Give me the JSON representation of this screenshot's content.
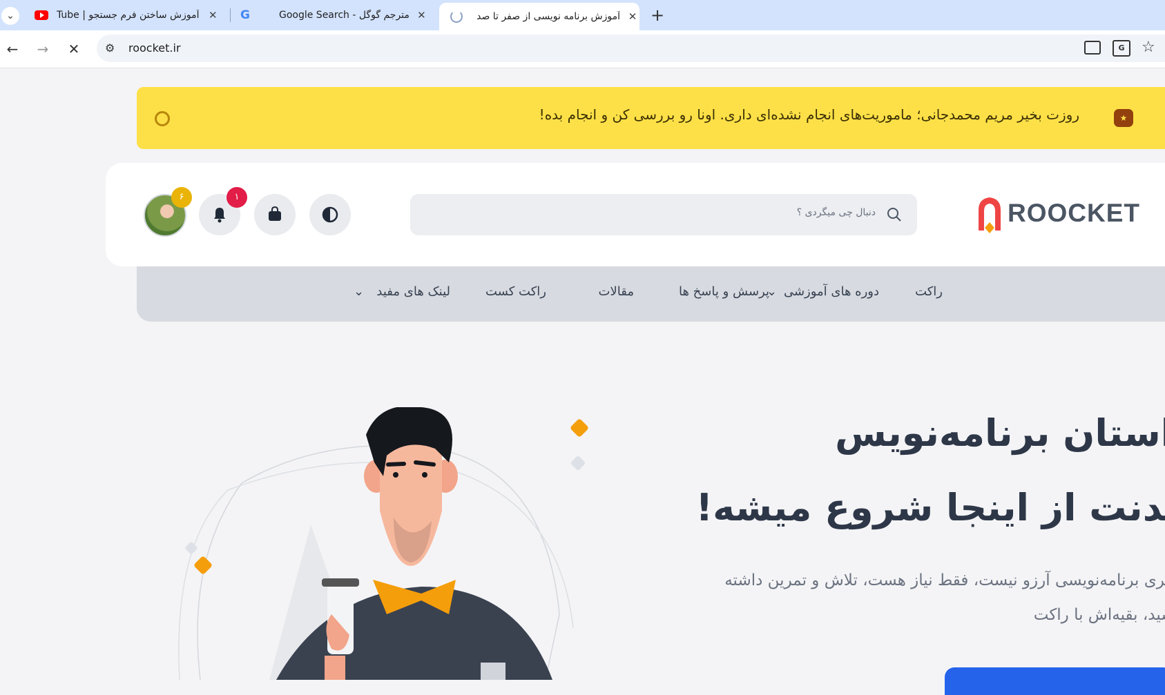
{
  "browser": {
    "tabs": [
      {
        "title": "آموزش ساختن فرم جستجو | YouTube",
        "icon": "youtube-icon"
      },
      {
        "title": "مترجم گوگل - Google Search",
        "icon": "google-icon"
      },
      {
        "title": "آموزش برنامه نویسی از صفر تا صد",
        "icon": "loading-spinner-icon",
        "active": true
      }
    ],
    "url": "roocket.ir"
  },
  "banner": {
    "text": "روزت بخیر مریم محمدجانی؛ ماموریت‌های انجام نشده‌ای داری. اونا رو بررسی کن و انجام بده!"
  },
  "header": {
    "logo_text": "ROOCKET",
    "search_placeholder": "دنبال چی میگردی ؟",
    "notification_count": "۱",
    "avatar_badge": "۶"
  },
  "menu": {
    "items": [
      "راکت",
      "دوره های آموزشی",
      "پرسش و پاسخ ها",
      "مقالات",
      "راکت کست",
      "لینک های مفید"
    ]
  },
  "hero": {
    "line1": "داستان برنامه‌نویس",
    "line2": "شدنت از اینجا شروع میشه!",
    "para1": "یادگیری برنامه‌نویسی آرزو نیست، فقط نیاز هست، تلاش و تمرین داشته",
    "para2": "باشید، بقیه‌اش با راکت"
  },
  "colors": {
    "accent": "#f59e0b",
    "brand_red": "#ef4444",
    "banner": "#fde047",
    "cta": "#2563eb"
  }
}
